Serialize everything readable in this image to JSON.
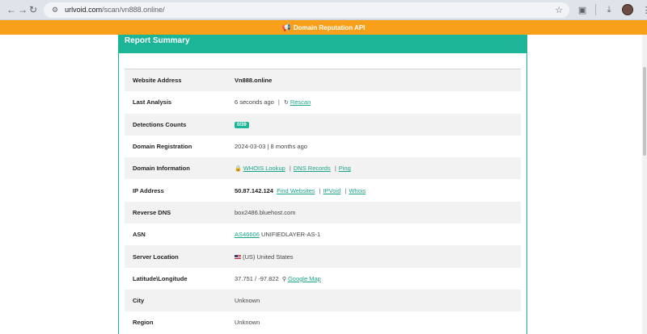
{
  "browser": {
    "url_host": "urlvoid.com",
    "url_path": "/scan/vn888.online/"
  },
  "banner": {
    "label": "Domain Reputation API"
  },
  "card": {
    "title": "Report Summary"
  },
  "rows": {
    "website_address": {
      "label": "Website Address",
      "value": "Vn888.online"
    },
    "last_analysis": {
      "label": "Last Analysis",
      "value": "6 seconds ago",
      "sep": "|",
      "link": "Rescan"
    },
    "detections": {
      "label": "Detections Counts",
      "badge": "0/39"
    },
    "registration": {
      "label": "Domain Registration",
      "value": "2024-03-03 | 8 months ago"
    },
    "domain_info": {
      "label": "Domain Information",
      "whois": "WHOIS Lookup",
      "dns": "DNS Records",
      "ping": "Ping",
      "sep": "|"
    },
    "ip": {
      "label": "IP Address",
      "value": "50.87.142.124",
      "find": "Find Websites",
      "ipvoid": "IPVoid",
      "whois": "Whois",
      "sep": "|"
    },
    "reverse_dns": {
      "label": "Reverse DNS",
      "value": "box2486.bluehost.com"
    },
    "asn": {
      "label": "ASN",
      "link": "AS46606",
      "value": "UNIFIEDLAYER-AS-1"
    },
    "server_location": {
      "label": "Server Location",
      "value": "(US) United States"
    },
    "latlong": {
      "label": "Latitude\\Longitude",
      "value": "37.751 / -97.822",
      "link": "Google Map"
    },
    "city": {
      "label": "City",
      "value": "Unknown"
    },
    "region": {
      "label": "Region",
      "value": "Unknown"
    }
  },
  "colors": {
    "accent": "#1cb597",
    "banner": "#f9a01b",
    "link": "#1aa58a"
  }
}
